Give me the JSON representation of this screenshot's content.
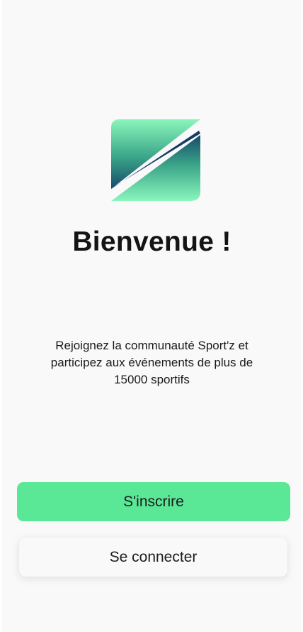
{
  "welcome": {
    "title": "Bienvenue !",
    "description": "Rejoignez la communauté Sport'z et participez aux événements de plus de 15000 sportifs"
  },
  "actions": {
    "signup_label": "S'inscrire",
    "login_label": "Se connecter"
  },
  "colors": {
    "primary": "#5ae897",
    "logo_light": "#88f5b8",
    "logo_dark": "#153d68",
    "background": "#f9f9f9"
  },
  "icons": {
    "logo": "sportz-z-logo-icon"
  }
}
